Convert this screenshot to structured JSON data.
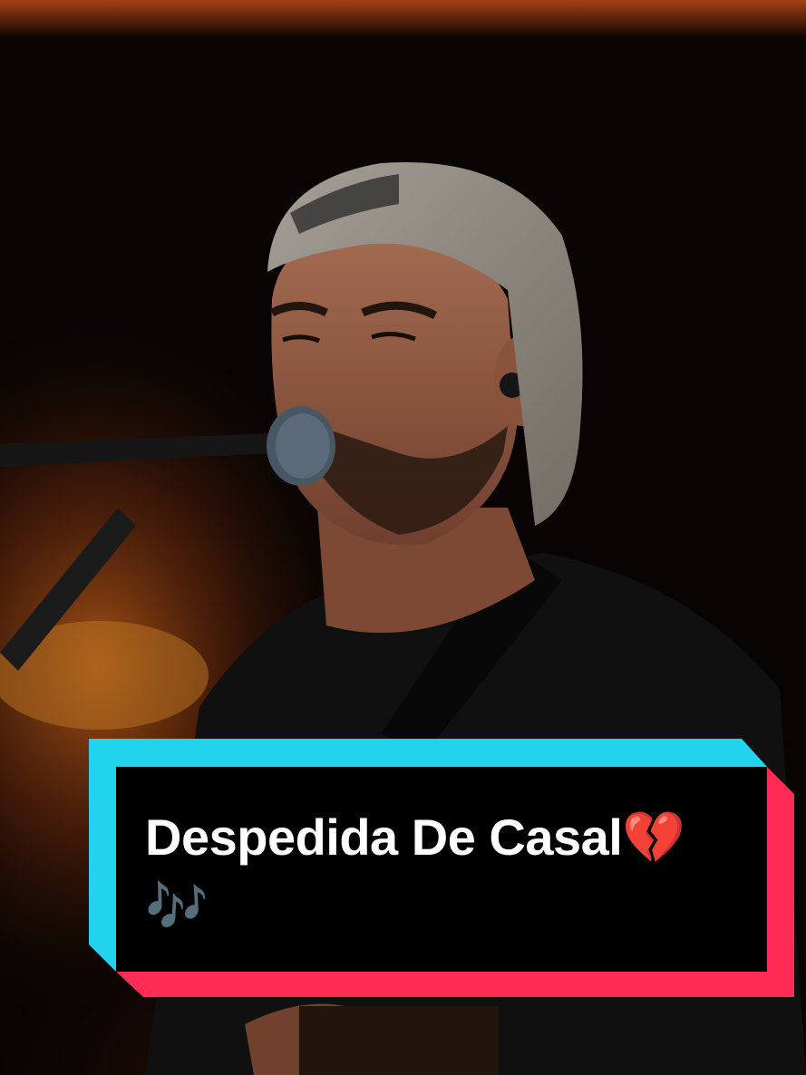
{
  "caption": {
    "title": "Despedida De Casal💔🎶"
  },
  "colors": {
    "frame_cyan": "#22d3ee",
    "frame_pink": "#fe2c55",
    "card_bg": "#000000",
    "text": "#ffffff"
  }
}
